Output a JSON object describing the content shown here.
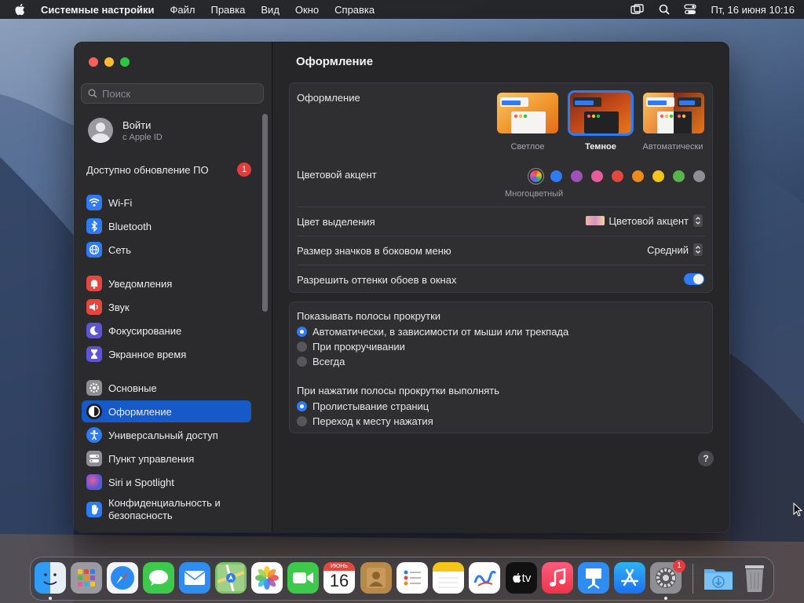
{
  "menubar": {
    "app_name": "Системные настройки",
    "items": [
      "Файл",
      "Правка",
      "Вид",
      "Окно",
      "Справка"
    ],
    "datetime": "Пт, 16 июня  10:16"
  },
  "sidebar": {
    "search_placeholder": "Поиск",
    "account": {
      "name": "Войти",
      "sub": "с Apple ID"
    },
    "update": {
      "label": "Доступно обновление ПО",
      "badge": "1"
    },
    "items": [
      {
        "label": "Wi-Fi",
        "icon": "wifi-icon",
        "color": "#2f7bf6"
      },
      {
        "label": "Bluetooth",
        "icon": "bluetooth-icon",
        "color": "#2f7bf6"
      },
      {
        "label": "Сеть",
        "icon": "globe-icon",
        "color": "#2f7bf6"
      },
      {
        "label": "Уведомления",
        "icon": "bell-icon",
        "color": "#e5463e"
      },
      {
        "label": "Звук",
        "icon": "speaker-icon",
        "color": "#e5463e"
      },
      {
        "label": "Фокусирование",
        "icon": "moon-icon",
        "color": "#5e55d6"
      },
      {
        "label": "Экранное время",
        "icon": "hourglass-icon",
        "color": "#5e55d6"
      },
      {
        "label": "Основные",
        "icon": "gear-icon",
        "color": "#8e8e93"
      },
      {
        "label": "Оформление",
        "icon": "appearance-icon",
        "color": "#1c1c1e"
      },
      {
        "label": "Универсальный доступ",
        "icon": "accessibility-icon",
        "color": "#2f7bf6"
      },
      {
        "label": "Пункт управления",
        "icon": "control-center-icon",
        "color": "#8e8e93"
      },
      {
        "label": "Siri и Spotlight",
        "icon": "siri-icon",
        "color": "#3a3a8c"
      },
      {
        "label": "Конфиденциальность и безопасность",
        "icon": "hand-icon",
        "color": "#2f7bf6"
      }
    ],
    "active_index": 8
  },
  "main": {
    "title": "Оформление",
    "appearance": {
      "label": "Оформление",
      "options": [
        "Светлое",
        "Темное",
        "Автоматически"
      ],
      "selected": "Темное"
    },
    "accent": {
      "label": "Цветовой акцент",
      "colors": [
        "#2f7bf6",
        "#9c52b8",
        "#e85c9b",
        "#e5463e",
        "#f08a1d",
        "#f5c518",
        "#5ab34a",
        "#8e8e93"
      ],
      "multicolor_label": "Многоцветный"
    },
    "highlight": {
      "label": "Цвет выделения",
      "value": "Цветовой акцент"
    },
    "icon_size": {
      "label": "Размер значков в боковом меню",
      "value": "Средний"
    },
    "tint": {
      "label": "Разрешить оттенки обоев в окнах",
      "on": true
    },
    "scrollbars": {
      "label": "Показывать полосы прокрутки",
      "options": [
        "Автоматически, в зависимости от мыши или трекпада",
        "При прокручивании",
        "Всегда"
      ],
      "selected_index": 0
    },
    "click": {
      "label": "При нажатии полосы прокрутки выполнять",
      "options": [
        "Пролистывание страниц",
        "Переход к месту нажатия"
      ],
      "selected_index": 0
    },
    "help": "?"
  },
  "dock": {
    "calendar_month": "ИЮНЬ",
    "calendar_day": "16",
    "tv_label": "tv",
    "settings_badge": "1"
  }
}
